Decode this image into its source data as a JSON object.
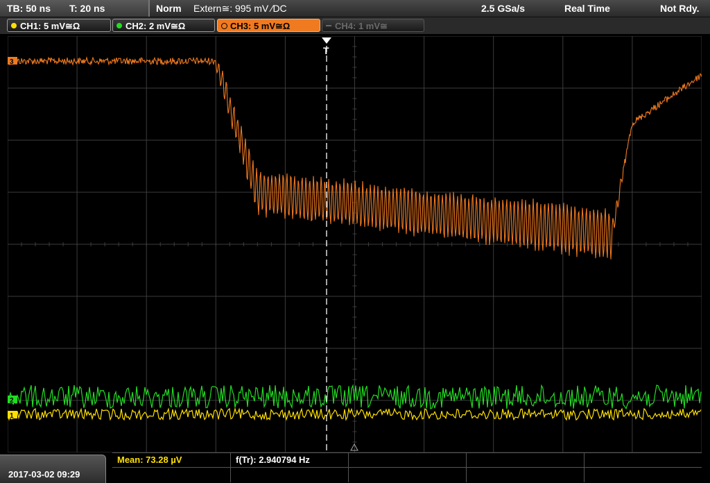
{
  "status": {
    "timebase": "TB: 50 ns",
    "trigger_time": "T: 20 ns",
    "mode": "Norm",
    "trigger_source": "Extern≅: 995 mV ∕DC",
    "sample_rate": "2.5 GSa/s",
    "acq_mode": "Real Time",
    "trigger_state": "Not Rdy."
  },
  "channels": [
    {
      "label": "CH1: 5 mV≅Ω",
      "color": "#ffe000",
      "state": "on"
    },
    {
      "label": "CH2: 2 mV≅Ω",
      "color": "#22dd22",
      "state": "on"
    },
    {
      "label": "CH3: 5 mV≅Ω",
      "color": "#f07a20",
      "state": "selected"
    },
    {
      "label": "CH4: 1 mV≅",
      "color": "#6a6a6a",
      "state": "off"
    }
  ],
  "markers": {
    "ch3": "3",
    "ch2": "2",
    "ch1": "1",
    "trigger": "T"
  },
  "measurements": {
    "mean": "Mean: 73.28 µV",
    "freq": "f(Tr): 2.940794 Hz"
  },
  "datetime": "2017-03-02 09:29",
  "colors": {
    "ch1": "#ffe000",
    "ch2": "#22dd22",
    "ch3": "#f07a20",
    "grid": "#3c3c3c"
  }
}
